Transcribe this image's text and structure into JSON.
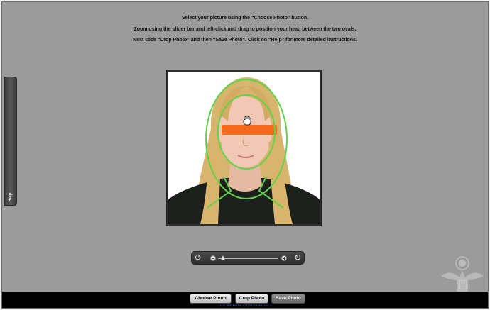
{
  "instructions": {
    "line1": "Select your picture using the “Choose Photo” button.",
    "line2": "Zoom using the slider bar and left-click and drag to position your head between the two ovals.",
    "line3": "Next click “Crop Photo” and then “Save Photo”.  Click on “Help” for more detailed instructions."
  },
  "help_tab": {
    "label": "Help"
  },
  "photo": {
    "guide_color": "#5fd34a",
    "redaction_color": "#f26a1b",
    "cursor_icon": "hand-cursor-icon"
  },
  "zoom": {
    "rotate_left_icon": "rotate-left-icon",
    "rotate_right_icon": "rotate-right-icon",
    "zoom_out_icon": "zoom-out-icon",
    "zoom_in_icon": "zoom-in-icon",
    "level": 0.08
  },
  "buttons": {
    "choose_photo": "Choose Photo",
    "crop_photo": "Crop Photo",
    "save_photo": "Save Photo"
  },
  "footer": {
    "version": "v1.0.900 Build 4/3/16:14:00 rev 4"
  },
  "seal_icon": "us-state-department-seal-icon"
}
